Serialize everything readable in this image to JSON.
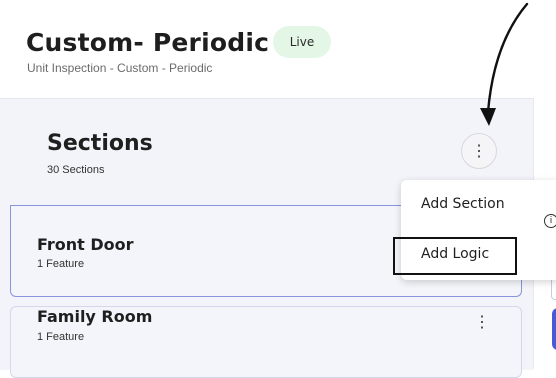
{
  "header": {
    "title": "Custom- Periodic",
    "status_badge": "Live",
    "subtitle": "Unit Inspection - Custom - Periodic"
  },
  "sections_panel": {
    "title": "Sections",
    "count_label": "30 Sections",
    "more_icon": "kebab-vertical-icon"
  },
  "section_cards": [
    {
      "title": "Front Door",
      "subtitle": "1 Feature"
    },
    {
      "title": "Family Room",
      "subtitle": "1 Feature"
    }
  ],
  "context_menu": {
    "items": [
      {
        "label": "Add Section",
        "icon": "info-icon"
      },
      {
        "label": "Add Logic",
        "highlighted": true
      }
    ]
  },
  "annotation": {
    "type": "arrow",
    "target": "more-options-button"
  },
  "colors": {
    "badge_bg": "#e4f6e6",
    "panel_bg": "#f3f4f9",
    "accent": "#4a5ad6",
    "selection_border": "#8a94dc"
  }
}
